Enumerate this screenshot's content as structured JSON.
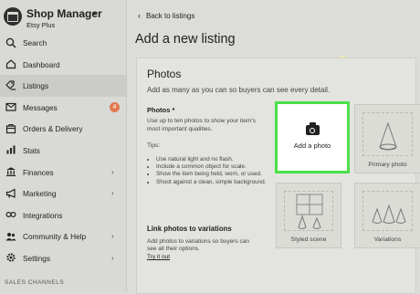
{
  "sidebar": {
    "shop_title": "Shop Manager",
    "shop_subtitle": "Etsy Plus",
    "items": [
      {
        "label": "Search",
        "icon": "search-icon"
      },
      {
        "label": "Dashboard",
        "icon": "home-icon"
      },
      {
        "label": "Listings",
        "icon": "listings-icon",
        "active": true
      },
      {
        "label": "Messages",
        "icon": "mail-icon",
        "badge": "4"
      },
      {
        "label": "Orders & Delivery",
        "icon": "orders-icon"
      },
      {
        "label": "Stats",
        "icon": "stats-icon"
      },
      {
        "label": "Finances",
        "icon": "bank-icon"
      },
      {
        "label": "Marketing",
        "icon": "megaphone-icon"
      },
      {
        "label": "Integrations",
        "icon": "integrations-icon"
      },
      {
        "label": "Community & Help",
        "icon": "community-icon"
      },
      {
        "label": "Settings",
        "icon": "gear-icon"
      }
    ],
    "sales_channels_heading": "SALES CHANNELS"
  },
  "main": {
    "back_link": "Back to listings",
    "page_title": "Add a new listing",
    "photos": {
      "title": "Photos",
      "subtitle": "Add as many as you can so buyers can see every detail.",
      "label": "Photos *",
      "description": "Use up to ten photos to show your item's most important qualities.",
      "tips_label": "Tips:",
      "tips": [
        "Use natural light and no flash.",
        "Include a common object for scale.",
        "Show the item being held, worn, or used.",
        "Shoot against a clean, simple background."
      ],
      "link_heading": "Link photos to variations",
      "link_description": "Add photos to variations so buyers can see all their options.",
      "try_link": "Try it out",
      "add_photo_label": "Add a photo",
      "slots": [
        "Primary photo",
        "Styled scene",
        "Variations"
      ]
    }
  },
  "colors": {
    "highlight": "#4ae04a",
    "badge": "#e07a4f"
  }
}
